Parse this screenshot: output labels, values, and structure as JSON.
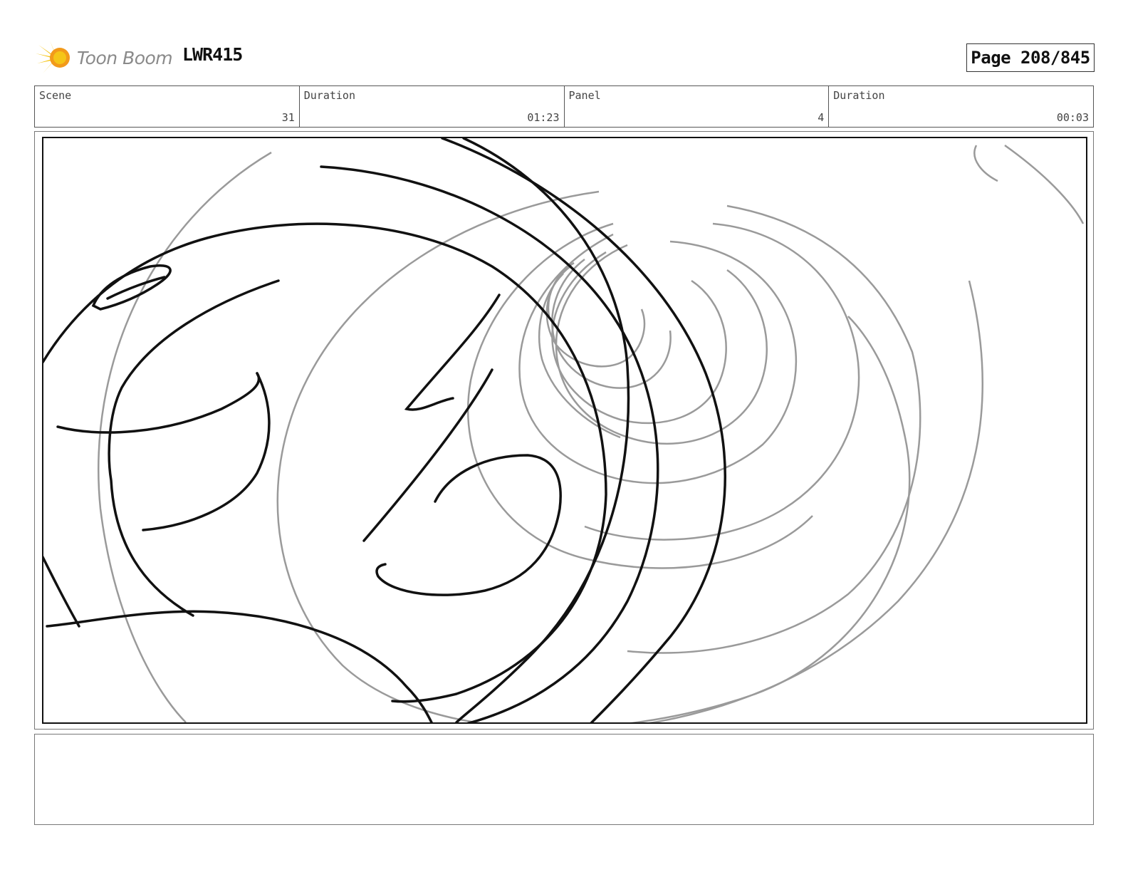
{
  "header": {
    "logo_text": "Toon Boom",
    "logo_icon": "toon-boom-star-icon",
    "project_code": "LWR415",
    "page_label": "Page 208/845"
  },
  "info_bar": {
    "scene_label": "Scene",
    "scene_value": "31",
    "scene_duration_label": "Duration",
    "scene_duration_value": "01:23",
    "panel_label": "Panel",
    "panel_value": "4",
    "panel_duration_label": "Duration",
    "panel_duration_value": "00:03"
  },
  "notes": {
    "text": ""
  },
  "colors": {
    "logo_yellow": "#f5c518",
    "logo_orange": "#f29a1b",
    "sketch_black": "#111111",
    "sketch_gray": "#9a9a9a"
  }
}
